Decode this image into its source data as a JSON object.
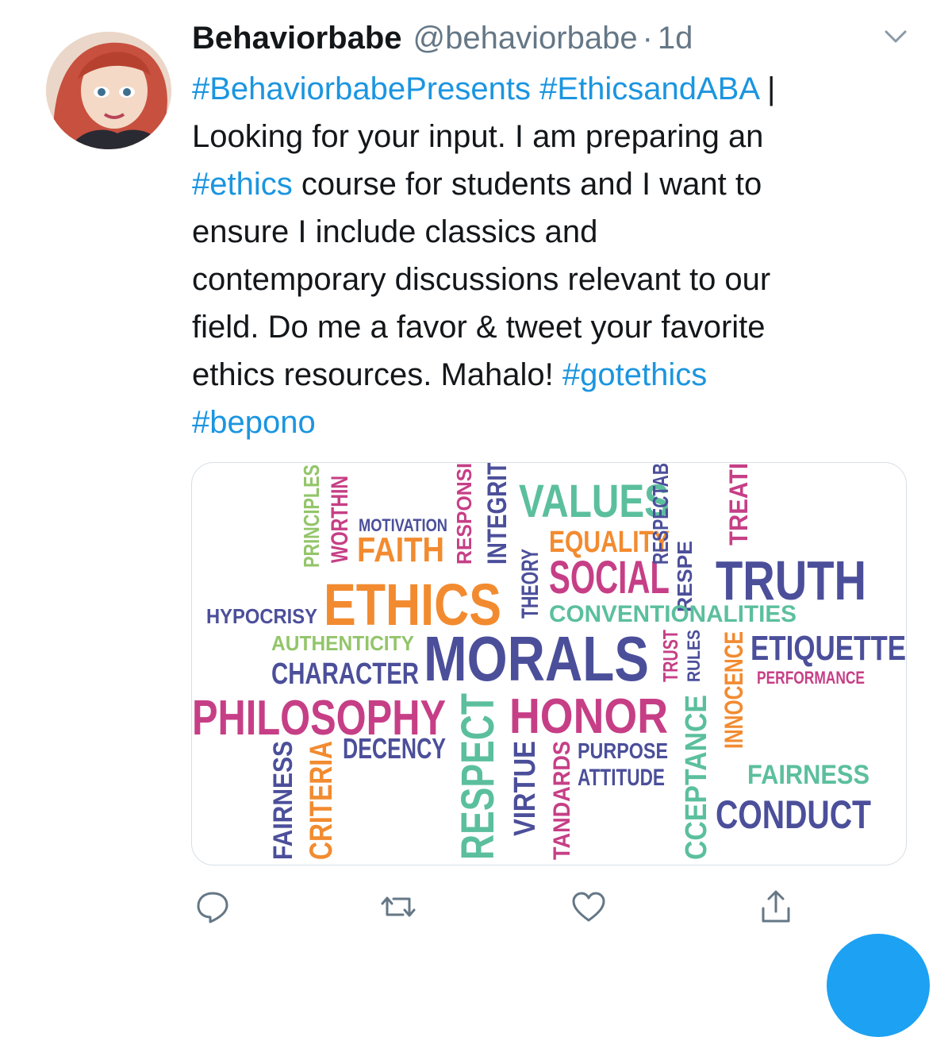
{
  "tweet": {
    "author_name": "Behaviorbabe",
    "author_handle": "@behaviorbabe",
    "separator": "·",
    "timestamp": "1d",
    "text_lines": [
      [
        {
          "t": "#BehaviorbabePresents",
          "tag": true
        },
        {
          "t": " "
        },
        {
          "t": "#EthicsandABA",
          "tag": true
        },
        {
          "t": " |"
        }
      ],
      [
        {
          "t": "Looking for your input. I am preparing an"
        }
      ],
      [
        {
          "t": "#ethics",
          "tag": true
        },
        {
          "t": " course for students and I want to"
        }
      ],
      [
        {
          "t": "ensure I include classics and"
        }
      ],
      [
        {
          "t": "contemporary discussions relevant to our"
        }
      ],
      [
        {
          "t": "field. Do me a favor & tweet your favorite"
        }
      ],
      [
        {
          "t": "ethics resources. Mahalo! "
        },
        {
          "t": "#gotethics",
          "tag": true
        }
      ],
      [
        {
          "t": "#bepono",
          "tag": true
        }
      ]
    ]
  },
  "colors": {
    "link": "#1b95e0",
    "text": "#14171a",
    "secondary": "#657786",
    "accent": "#1da1f2"
  },
  "icons": {
    "more": "chevron-down-icon",
    "reply": "reply-icon",
    "retweet": "retweet-icon",
    "like": "heart-icon",
    "share": "share-icon"
  },
  "wordcloud": {
    "words": [
      {
        "id": "principles",
        "text": "PRINCIPLES",
        "color": "#93c56a"
      },
      {
        "id": "worthiness",
        "text": "WORTHIN",
        "color": "#c63f86"
      },
      {
        "id": "motivation",
        "text": "MOTIVATION",
        "color": "#4b4f9a"
      },
      {
        "id": "faith",
        "text": "FAITH",
        "color": "#f28b30"
      },
      {
        "id": "responsibility",
        "text": "RESPONSI",
        "color": "#c63f86"
      },
      {
        "id": "integrity",
        "text": "INTEGRIT",
        "color": "#4b4f9a"
      },
      {
        "id": "values",
        "text": "VALUES",
        "color": "#5bbf9d"
      },
      {
        "id": "theory",
        "text": "THEORY",
        "color": "#4b4f9a"
      },
      {
        "id": "equality",
        "text": "EQUALITY",
        "color": "#f28b30"
      },
      {
        "id": "social",
        "text": "SOCIAL",
        "color": "#c63f86"
      },
      {
        "id": "respectable",
        "text": "RESPECTAB",
        "color": "#4b4f9a"
      },
      {
        "id": "respect-small",
        "text": "RESPE",
        "color": "#4b4f9a"
      },
      {
        "id": "treatment",
        "text": "TREATI",
        "color": "#c63f86"
      },
      {
        "id": "truth",
        "text": "TRUTH",
        "color": "#4b4f9a"
      },
      {
        "id": "hypocrisy",
        "text": "HYPOCRISY",
        "color": "#4b4f9a"
      },
      {
        "id": "ethics",
        "text": "ETHICS",
        "color": "#f28b30"
      },
      {
        "id": "conventionalities",
        "text": "CONVENTIONALITIES",
        "color": "#5bbf9d"
      },
      {
        "id": "authenticity",
        "text": "AUTHENTICITY",
        "color": "#93c56a"
      },
      {
        "id": "morals",
        "text": "MORALS",
        "color": "#4b4f9a"
      },
      {
        "id": "trust",
        "text": "TRUST",
        "color": "#c63f86"
      },
      {
        "id": "rules",
        "text": "RULES",
        "color": "#4b4f9a"
      },
      {
        "id": "innocence",
        "text": "INNOCENCE",
        "color": "#f28b30"
      },
      {
        "id": "etiquette",
        "text": "ETIQUETTE",
        "color": "#4b4f9a"
      },
      {
        "id": "character",
        "text": "CHARACTER",
        "color": "#4b4f9a"
      },
      {
        "id": "performance",
        "text": "PERFORMANCE",
        "color": "#c63f86"
      },
      {
        "id": "philosophy",
        "text": "PHILOSOPHY",
        "color": "#c63f86"
      },
      {
        "id": "respect",
        "text": "RESPECT",
        "color": "#5bbf9d"
      },
      {
        "id": "honor",
        "text": "HONOR",
        "color": "#c63f86"
      },
      {
        "id": "acceptance",
        "text": "CCEPTANCE",
        "color": "#5bbf9d"
      },
      {
        "id": "fairness-v",
        "text": "FAIRNESS",
        "color": "#4b4f9a"
      },
      {
        "id": "criteria",
        "text": "CRITERIA",
        "color": "#f28b30"
      },
      {
        "id": "decency",
        "text": "DECENCY",
        "color": "#4b4f9a"
      },
      {
        "id": "virtue",
        "text": "VIRTUE",
        "color": "#4b4f9a"
      },
      {
        "id": "standards",
        "text": "TANDARDS",
        "color": "#c63f86"
      },
      {
        "id": "purpose",
        "text": "PURPOSE",
        "color": "#4b4f9a"
      },
      {
        "id": "attitude",
        "text": "ATTITUDE",
        "color": "#4b4f9a"
      },
      {
        "id": "fairness-h",
        "text": "FAIRNESS",
        "color": "#5bbf9d"
      },
      {
        "id": "conduct",
        "text": "CONDUCT",
        "color": "#4b4f9a"
      }
    ]
  }
}
